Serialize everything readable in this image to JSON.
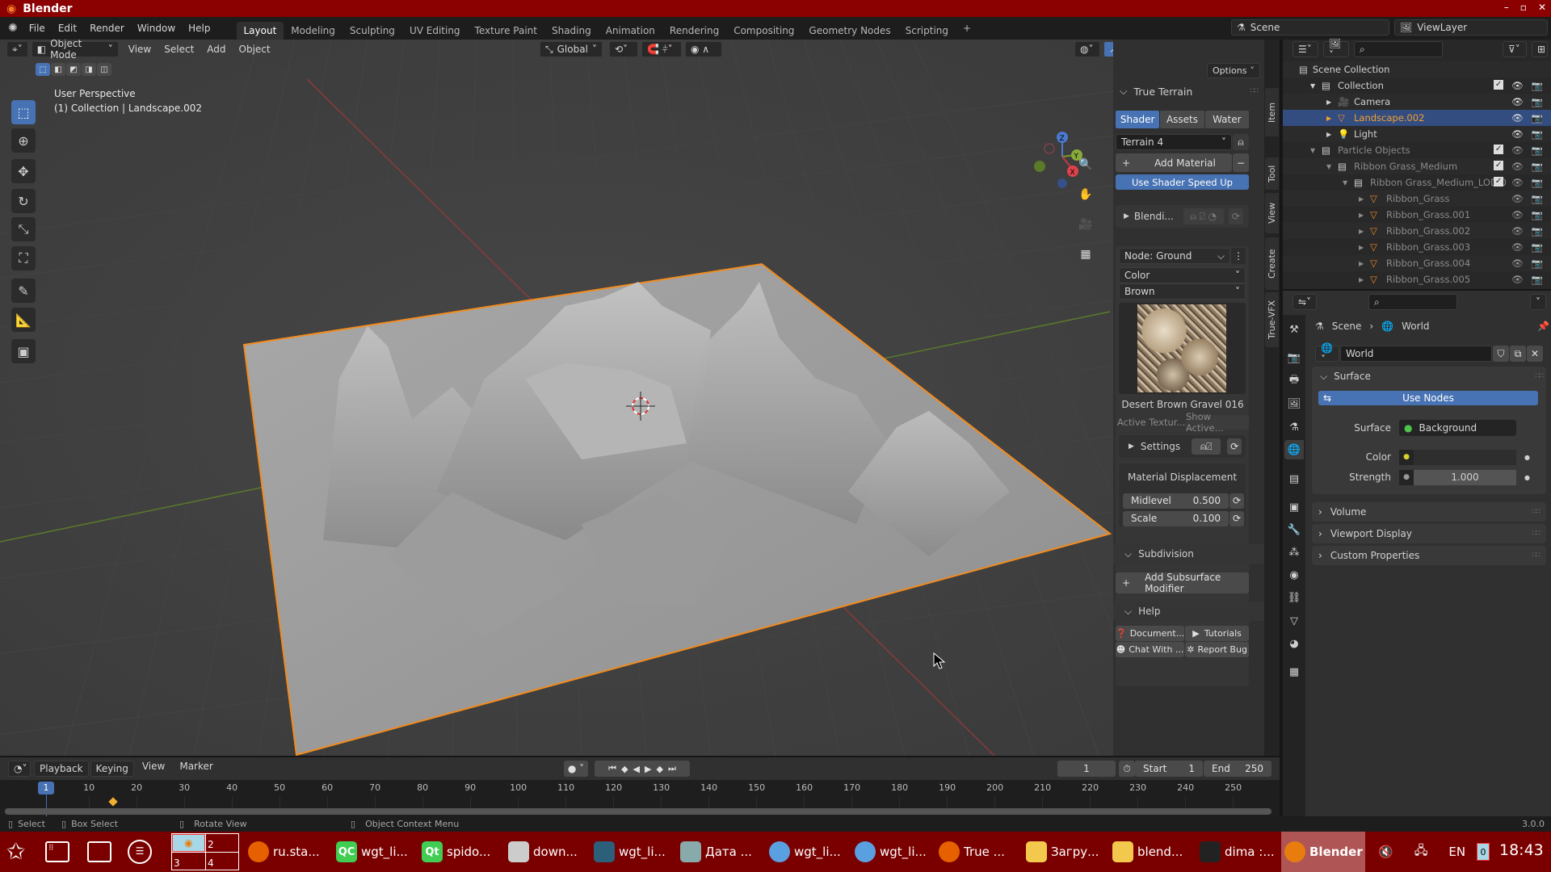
{
  "colors": {
    "accent": "#4772b3",
    "selected_object": "#f0a030",
    "titlebar": "#8b0000",
    "taskbar": "#7a0000",
    "outline": "#f28b1e"
  },
  "window": {
    "title": "Blender",
    "controls": [
      "–",
      "▫",
      "✕"
    ]
  },
  "menu": [
    "File",
    "Edit",
    "Render",
    "Window",
    "Help"
  ],
  "workspaces": [
    {
      "label": "Layout",
      "active": true
    },
    {
      "label": "Modeling"
    },
    {
      "label": "Sculpting"
    },
    {
      "label": "UV Editing"
    },
    {
      "label": "Texture Paint"
    },
    {
      "label": "Shading"
    },
    {
      "label": "Animation"
    },
    {
      "label": "Rendering"
    },
    {
      "label": "Compositing"
    },
    {
      "label": "Geometry Nodes"
    },
    {
      "label": "Scripting"
    }
  ],
  "workspace_add": "+",
  "scene": {
    "name": "Scene",
    "view_layer": "ViewLayer"
  },
  "viewport": {
    "mode": "Object Mode",
    "menus": [
      "View",
      "Select",
      "Add",
      "Object"
    ],
    "orientation": "Global",
    "options": "Options",
    "overlay_line1": "User Perspective",
    "overlay_line2": "(1) Collection | Landscape.002",
    "tools": [
      "select-box-icon",
      "cursor-icon",
      "move-icon",
      "rotate-icon",
      "scale-icon",
      "transform-icon",
      "annotate-icon",
      "measure-icon",
      "add-cube-icon"
    ],
    "tool_glyphs": [
      "⬚",
      "⊕",
      "✥",
      "↻",
      "⤡",
      "⛶",
      "✎",
      "📐",
      "▣"
    ],
    "nav": [
      {
        "name": "zoom-icon",
        "glyph": "🔍"
      },
      {
        "name": "pan-hand-icon",
        "glyph": "✋"
      },
      {
        "name": "camera-view-icon",
        "glyph": "🎥"
      },
      {
        "name": "ortho-grid-icon",
        "glyph": "▦"
      }
    ],
    "gizmo": {
      "x": "X",
      "y": "Y",
      "z": "Z"
    }
  },
  "npanel": {
    "tabs": [
      "Item",
      "Tool",
      "View",
      "Create",
      "True-VFX"
    ],
    "title": "True Terrain",
    "subtabs": [
      {
        "label": "Shader",
        "active": true
      },
      {
        "label": "Assets"
      },
      {
        "label": "Water"
      }
    ],
    "terrain_select": "Terrain 4",
    "add_material": "Add Material",
    "speed_up": "Use Shader Speed Up",
    "blending": "Blendi...",
    "node_select": "Node: Ground",
    "channel": "Color",
    "preset": "Brown",
    "texture_name": "Desert Brown Gravel 016",
    "active_texture": "Active Textur...",
    "show_active": "Show Active...",
    "settings": "Settings",
    "displacement_title": "Material Displacement",
    "midlevel": {
      "label": "Midlevel",
      "value": "0.500"
    },
    "scale": {
      "label": "Scale",
      "value": "0.100"
    },
    "subdivision": "Subdivision",
    "add_subsurf": "Add Subsurface Modifier",
    "help": "Help",
    "help_buttons": [
      "Document...",
      "Tutorials",
      "Chat With ...",
      "Report Bug"
    ]
  },
  "outliner": {
    "root": "Scene Collection",
    "rows": [
      {
        "label": "Collection",
        "depth": 0,
        "kind": "collection",
        "check": true,
        "expanded": true
      },
      {
        "label": "Camera",
        "depth": 1,
        "kind": "camera"
      },
      {
        "label": "Landscape.002",
        "depth": 1,
        "kind": "mesh",
        "selected": true
      },
      {
        "label": "Light",
        "depth": 1,
        "kind": "light"
      },
      {
        "label": "Particle Objects",
        "depth": 0,
        "kind": "collection",
        "check": true,
        "expanded": true,
        "dim": true
      },
      {
        "label": "Ribbon Grass_Medium",
        "depth": 1,
        "kind": "collection",
        "check": true,
        "expanded": true,
        "dim": true
      },
      {
        "label": "Ribbon Grass_Medium_LOD 0",
        "depth": 2,
        "kind": "collection",
        "check": true,
        "expanded": true,
        "dim": true
      },
      {
        "label": "Ribbon_Grass",
        "depth": 3,
        "kind": "mesh",
        "dim": true
      },
      {
        "label": "Ribbon_Grass.001",
        "depth": 3,
        "kind": "mesh",
        "dim": true
      },
      {
        "label": "Ribbon_Grass.002",
        "depth": 3,
        "kind": "mesh",
        "dim": true
      },
      {
        "label": "Ribbon_Grass.003",
        "depth": 3,
        "kind": "mesh",
        "dim": true
      },
      {
        "label": "Ribbon_Grass.004",
        "depth": 3,
        "kind": "mesh",
        "dim": true
      },
      {
        "label": "Ribbon_Grass.005",
        "depth": 3,
        "kind": "mesh",
        "dim": true
      }
    ]
  },
  "properties": {
    "tabs": [
      "tool-icon",
      "render-icon",
      "output-icon",
      "view-layer-icon",
      "scene-icon",
      "world-icon",
      "collection-icon",
      "object-icon",
      "modifier-icon",
      "particles-icon",
      "physics-icon",
      "constraints-icon",
      "data-icon",
      "material-icon",
      "texture-icon"
    ],
    "tab_glyphs": [
      "⚒",
      "📷",
      "🖶",
      "🖼",
      "⚗",
      "🌐",
      "▤",
      "▣",
      "🔧",
      "⁂",
      "◉",
      "⛓",
      "▽",
      "◕",
      "▦"
    ],
    "active_tab": 5,
    "breadcrumb": [
      "Scene",
      "World"
    ],
    "world_name": "World",
    "surface_header": "Surface",
    "use_nodes": "Use Nodes",
    "surface_label": "Surface",
    "surface_value": "Background",
    "color_label": "Color",
    "strength_label": "Strength",
    "strength_value": "1.000",
    "collapsed": [
      "Volume",
      "Viewport Display",
      "Custom Properties"
    ]
  },
  "timeline": {
    "menus": [
      "Playback",
      "Keying",
      "View",
      "Marker"
    ],
    "current_frame": "1",
    "start_label": "Start",
    "start": "1",
    "end_label": "End",
    "end": "250",
    "ticks": [
      10,
      20,
      30,
      40,
      50,
      60,
      70,
      80,
      90,
      100,
      110,
      120,
      130,
      140,
      150,
      160,
      170,
      180,
      190,
      200,
      210,
      220,
      230,
      240,
      250
    ],
    "current": 1,
    "keyframe": 15
  },
  "statusbar": {
    "items": [
      "Select",
      "Box Select",
      "Rotate View",
      "Object Context Menu"
    ],
    "version": "3.0.0"
  },
  "taskbar": {
    "pager": [
      "2",
      "3",
      "4"
    ],
    "tasks": [
      {
        "label": "ru.sta...",
        "icon": "firefox-icon",
        "color": "#e66000"
      },
      {
        "label": "wgt_li...",
        "icon": "qtcreator-icon",
        "color": "#41cd52",
        "glyph": "QC"
      },
      {
        "label": "spido...",
        "icon": "qt-icon",
        "color": "#41cd52",
        "glyph": "Qt"
      },
      {
        "label": "down...",
        "icon": "viewer-icon",
        "color": "#ccc"
      },
      {
        "label": "wgt_li...",
        "icon": "app-icon",
        "color": "#2b5f7a"
      },
      {
        "label": "Дата ...",
        "icon": "clock-icon",
        "color": "#8aa"
      },
      {
        "label": "wgt_li...",
        "icon": "rocket-icon",
        "color": "#5aa0e0"
      },
      {
        "label": "wgt_li...",
        "icon": "rocket-icon",
        "color": "#5aa0e0"
      },
      {
        "label": "True ...",
        "icon": "firefox-icon",
        "color": "#e66000"
      },
      {
        "label": "Загру...",
        "icon": "download-folder-icon",
        "color": "#f2c94c"
      },
      {
        "label": "blend...",
        "icon": "folder-icon",
        "color": "#f2c94c"
      },
      {
        "label": "dima :...",
        "icon": "terminal-icon",
        "color": "#222"
      },
      {
        "label": "Blender",
        "icon": "blender-icon",
        "color": "#e87d0d",
        "active": true
      }
    ],
    "language": "EN",
    "notifications": "0",
    "clock": "18:43"
  }
}
